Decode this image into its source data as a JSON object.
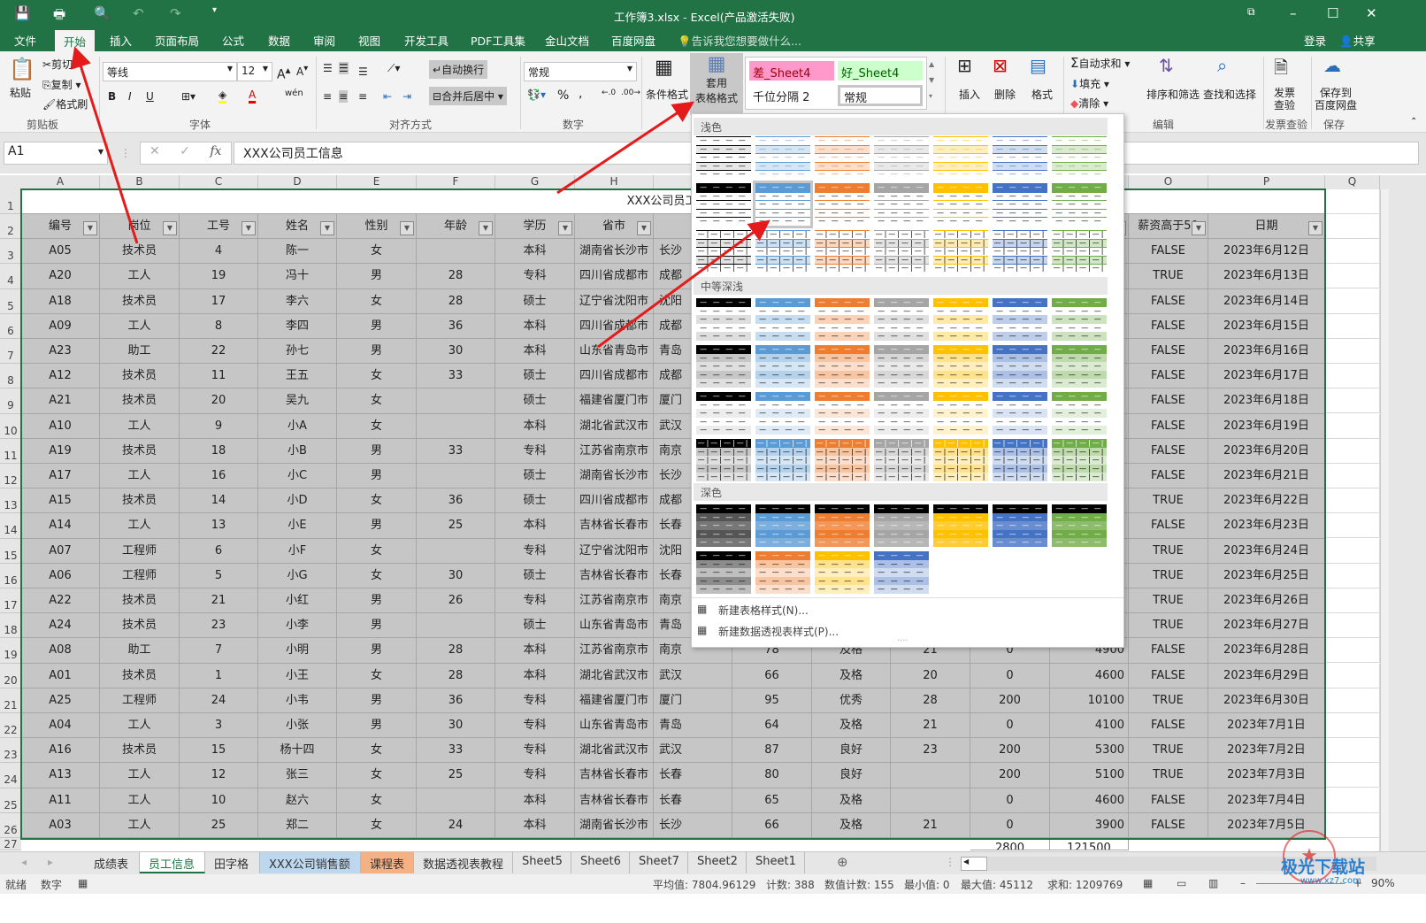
{
  "window": {
    "title": "工作簿3.xlsx - Excel(产品激活失败)"
  },
  "menu_tabs": [
    "文件",
    "开始",
    "插入",
    "页面布局",
    "公式",
    "数据",
    "审阅",
    "视图",
    "开发工具",
    "PDF工具集",
    "金山文档",
    "百度网盘"
  ],
  "tell_me": "告诉我您想要做什么...",
  "login": "登录",
  "share": "共享",
  "ribbon": {
    "paste": "粘贴",
    "cut": "剪切",
    "copy": "复制",
    "format_painter": "格式刷",
    "clipboard": "剪贴板",
    "font_name": "等线",
    "font_size": "12",
    "font_group": "字体",
    "bold": "B",
    "italic": "I",
    "underline": "U",
    "wrap": "自动换行",
    "merge": "合并后居中",
    "align_group": "对齐方式",
    "number_format": "常规",
    "number_group": "数字",
    "percent": "%",
    "comma": ",",
    "cond_format": "条件格式",
    "table_format_1": "套用",
    "table_format_2": "表格格式",
    "styles": [
      "差_Sheet4",
      "好_Sheet4",
      "千位分隔 2",
      "常规"
    ],
    "insert": "插入",
    "delete": "删除",
    "format": "格式",
    "autosum": "自动求和",
    "fill": "填充",
    "clear": "清除",
    "sort": "排序和筛选",
    "find": "查找和选择",
    "edit_group": "编辑",
    "invoice_1": "发票",
    "invoice_2": "查验",
    "invoice_group": "发票查验",
    "save_baidu_1": "保存到",
    "save_baidu_2": "百度网盘",
    "save_group": "保存"
  },
  "formula_bar": {
    "name_box": "A1",
    "fx": "fx",
    "value": "XXX公司员工信息"
  },
  "columns": [
    "A",
    "B",
    "C",
    "D",
    "E",
    "F",
    "G",
    "H",
    "I",
    "J",
    "K",
    "L",
    "M",
    "N",
    "O",
    "P",
    "Q"
  ],
  "sheet": {
    "title": "XXX公司员工信息",
    "headers": [
      "编号",
      "岗位",
      "工号",
      "姓名",
      "性别",
      "年龄",
      "学历",
      "省市",
      "",
      "",
      "",
      "",
      "",
      "",
      "薪资高于50",
      "日期"
    ],
    "rows": [
      [
        "A05",
        "技术员",
        "4",
        "陈一",
        "女",
        "",
        "本科",
        "湖南省长沙市",
        "长沙",
        "",
        "",
        "",
        "",
        "",
        "FALSE",
        "2023年6月12日"
      ],
      [
        "A20",
        "工人",
        "19",
        "冯十",
        "男",
        "28",
        "专科",
        "四川省成都市",
        "成都",
        "",
        "",
        "",
        "",
        "",
        "TRUE",
        "2023年6月13日"
      ],
      [
        "A18",
        "技术员",
        "17",
        "李六",
        "女",
        "28",
        "硕士",
        "辽宁省沈阳市",
        "沈阳",
        "",
        "",
        "",
        "",
        "",
        "FALSE",
        "2023年6月14日"
      ],
      [
        "A09",
        "工人",
        "8",
        "李四",
        "男",
        "36",
        "本科",
        "四川省成都市",
        "成都",
        "",
        "",
        "",
        "",
        "",
        "FALSE",
        "2023年6月15日"
      ],
      [
        "A23",
        "助工",
        "22",
        "孙七",
        "男",
        "30",
        "本科",
        "山东省青岛市",
        "青岛",
        "",
        "",
        "",
        "",
        "",
        "FALSE",
        "2023年6月16日"
      ],
      [
        "A12",
        "技术员",
        "11",
        "王五",
        "女",
        "33",
        "硕士",
        "四川省成都市",
        "成都",
        "",
        "",
        "",
        "",
        "",
        "FALSE",
        "2023年6月17日"
      ],
      [
        "A21",
        "技术员",
        "20",
        "吴九",
        "女",
        "",
        "硕士",
        "福建省厦门市",
        "厦门",
        "",
        "",
        "",
        "",
        "",
        "FALSE",
        "2023年6月18日"
      ],
      [
        "A10",
        "工人",
        "9",
        "小A",
        "女",
        "",
        "本科",
        "湖北省武汉市",
        "武汉",
        "",
        "",
        "",
        "",
        "",
        "FALSE",
        "2023年6月19日"
      ],
      [
        "A19",
        "技术员",
        "18",
        "小B",
        "男",
        "33",
        "专科",
        "江苏省南京市",
        "南京",
        "",
        "",
        "",
        "",
        "",
        "FALSE",
        "2023年6月20日"
      ],
      [
        "A17",
        "工人",
        "16",
        "小C",
        "男",
        "",
        "硕士",
        "湖南省长沙市",
        "长沙",
        "",
        "",
        "",
        "",
        "",
        "FALSE",
        "2023年6月21日"
      ],
      [
        "A15",
        "技术员",
        "14",
        "小D",
        "女",
        "36",
        "硕士",
        "四川省成都市",
        "成都",
        "",
        "",
        "",
        "",
        "",
        "TRUE",
        "2023年6月22日"
      ],
      [
        "A14",
        "工人",
        "13",
        "小E",
        "男",
        "25",
        "本科",
        "吉林省长春市",
        "长春",
        "",
        "",
        "",
        "",
        "",
        "FALSE",
        "2023年6月23日"
      ],
      [
        "A07",
        "工程师",
        "6",
        "小F",
        "女",
        "",
        "专科",
        "辽宁省沈阳市",
        "沈阳",
        "",
        "",
        "",
        "",
        "",
        "TRUE",
        "2023年6月24日"
      ],
      [
        "A06",
        "工程师",
        "5",
        "小G",
        "女",
        "30",
        "硕士",
        "吉林省长春市",
        "长春",
        "",
        "",
        "",
        "",
        "",
        "TRUE",
        "2023年6月25日"
      ],
      [
        "A22",
        "技术员",
        "21",
        "小红",
        "男",
        "26",
        "专科",
        "江苏省南京市",
        "南京",
        "",
        "",
        "",
        "",
        "",
        "TRUE",
        "2023年6月26日"
      ],
      [
        "A24",
        "技术员",
        "23",
        "小李",
        "男",
        "",
        "硕士",
        "山东省青岛市",
        "青岛",
        "",
        "",
        "",
        "",
        "",
        "TRUE",
        "2023年6月27日"
      ],
      [
        "A08",
        "助工",
        "7",
        "小明",
        "男",
        "28",
        "本科",
        "江苏省南京市",
        "南京",
        "78",
        "及格",
        "21",
        "0",
        "4900",
        "FALSE",
        "2023年6月28日"
      ],
      [
        "A01",
        "技术员",
        "1",
        "小王",
        "女",
        "28",
        "本科",
        "湖北省武汉市",
        "武汉",
        "66",
        "及格",
        "20",
        "0",
        "4600",
        "FALSE",
        "2023年6月29日"
      ],
      [
        "A25",
        "工程师",
        "24",
        "小韦",
        "男",
        "36",
        "专科",
        "福建省厦门市",
        "厦门",
        "95",
        "优秀",
        "28",
        "200",
        "10100",
        "TRUE",
        "2023年6月30日"
      ],
      [
        "A04",
        "工人",
        "3",
        "小张",
        "男",
        "30",
        "专科",
        "山东省青岛市",
        "青岛",
        "64",
        "及格",
        "21",
        "0",
        "4100",
        "FALSE",
        "2023年7月1日"
      ],
      [
        "A16",
        "技术员",
        "15",
        "杨十四",
        "女",
        "33",
        "专科",
        "湖北省武汉市",
        "武汉",
        "87",
        "良好",
        "23",
        "200",
        "5300",
        "TRUE",
        "2023年7月2日"
      ],
      [
        "A13",
        "工人",
        "12",
        "张三",
        "女",
        "25",
        "专科",
        "吉林省长春市",
        "长春",
        "80",
        "良好",
        "",
        "200",
        "5100",
        "TRUE",
        "2023年7月3日"
      ],
      [
        "A11",
        "工人",
        "10",
        "赵六",
        "女",
        "",
        "本科",
        "吉林省长春市",
        "长春",
        "65",
        "及格",
        "",
        "0",
        "4600",
        "FALSE",
        "2023年7月4日"
      ],
      [
        "A03",
        "工人",
        "25",
        "郑二",
        "女",
        "24",
        "本科",
        "湖南省长沙市",
        "长沙",
        "66",
        "及格",
        "21",
        "0",
        "3900",
        "FALSE",
        "2023年7月5日"
      ]
    ],
    "totals": {
      "M": "2800",
      "N": "121500"
    }
  },
  "table_styles_menu": {
    "sections": [
      "浅色",
      "中等深浅",
      "深色"
    ],
    "colors": [
      "#000000",
      "#5b9bd5",
      "#ed7d31",
      "#a5a5a5",
      "#ffc000",
      "#4472c4",
      "#70ad47"
    ],
    "items": [
      "新建表格样式(N)...",
      "新建数据透视表样式(P)..."
    ]
  },
  "sheet_tabs": [
    {
      "label": "成绩表"
    },
    {
      "label": "员工信息",
      "active": true
    },
    {
      "label": "田字格"
    },
    {
      "label": "XXX公司销售额",
      "color": "#bdd7ee"
    },
    {
      "label": "课程表",
      "color": "#f4b183"
    },
    {
      "label": "数据透视表教程"
    },
    {
      "label": "Sheet5"
    },
    {
      "label": "Sheet6"
    },
    {
      "label": "Sheet7"
    },
    {
      "label": "Sheet2"
    },
    {
      "label": "Sheet1"
    }
  ],
  "status": {
    "ready": "就绪",
    "num": "数字",
    "avg": "平均值: 7804.96129",
    "count": "计数: 388",
    "numcount": "数值计数: 155",
    "min": "最小值: 0",
    "max": "最大值: 45112",
    "sum": "求和: 1209769",
    "zoom": "90%"
  },
  "watermark": {
    "logo": "极光下载站",
    "url": "www.xz7.com"
  }
}
